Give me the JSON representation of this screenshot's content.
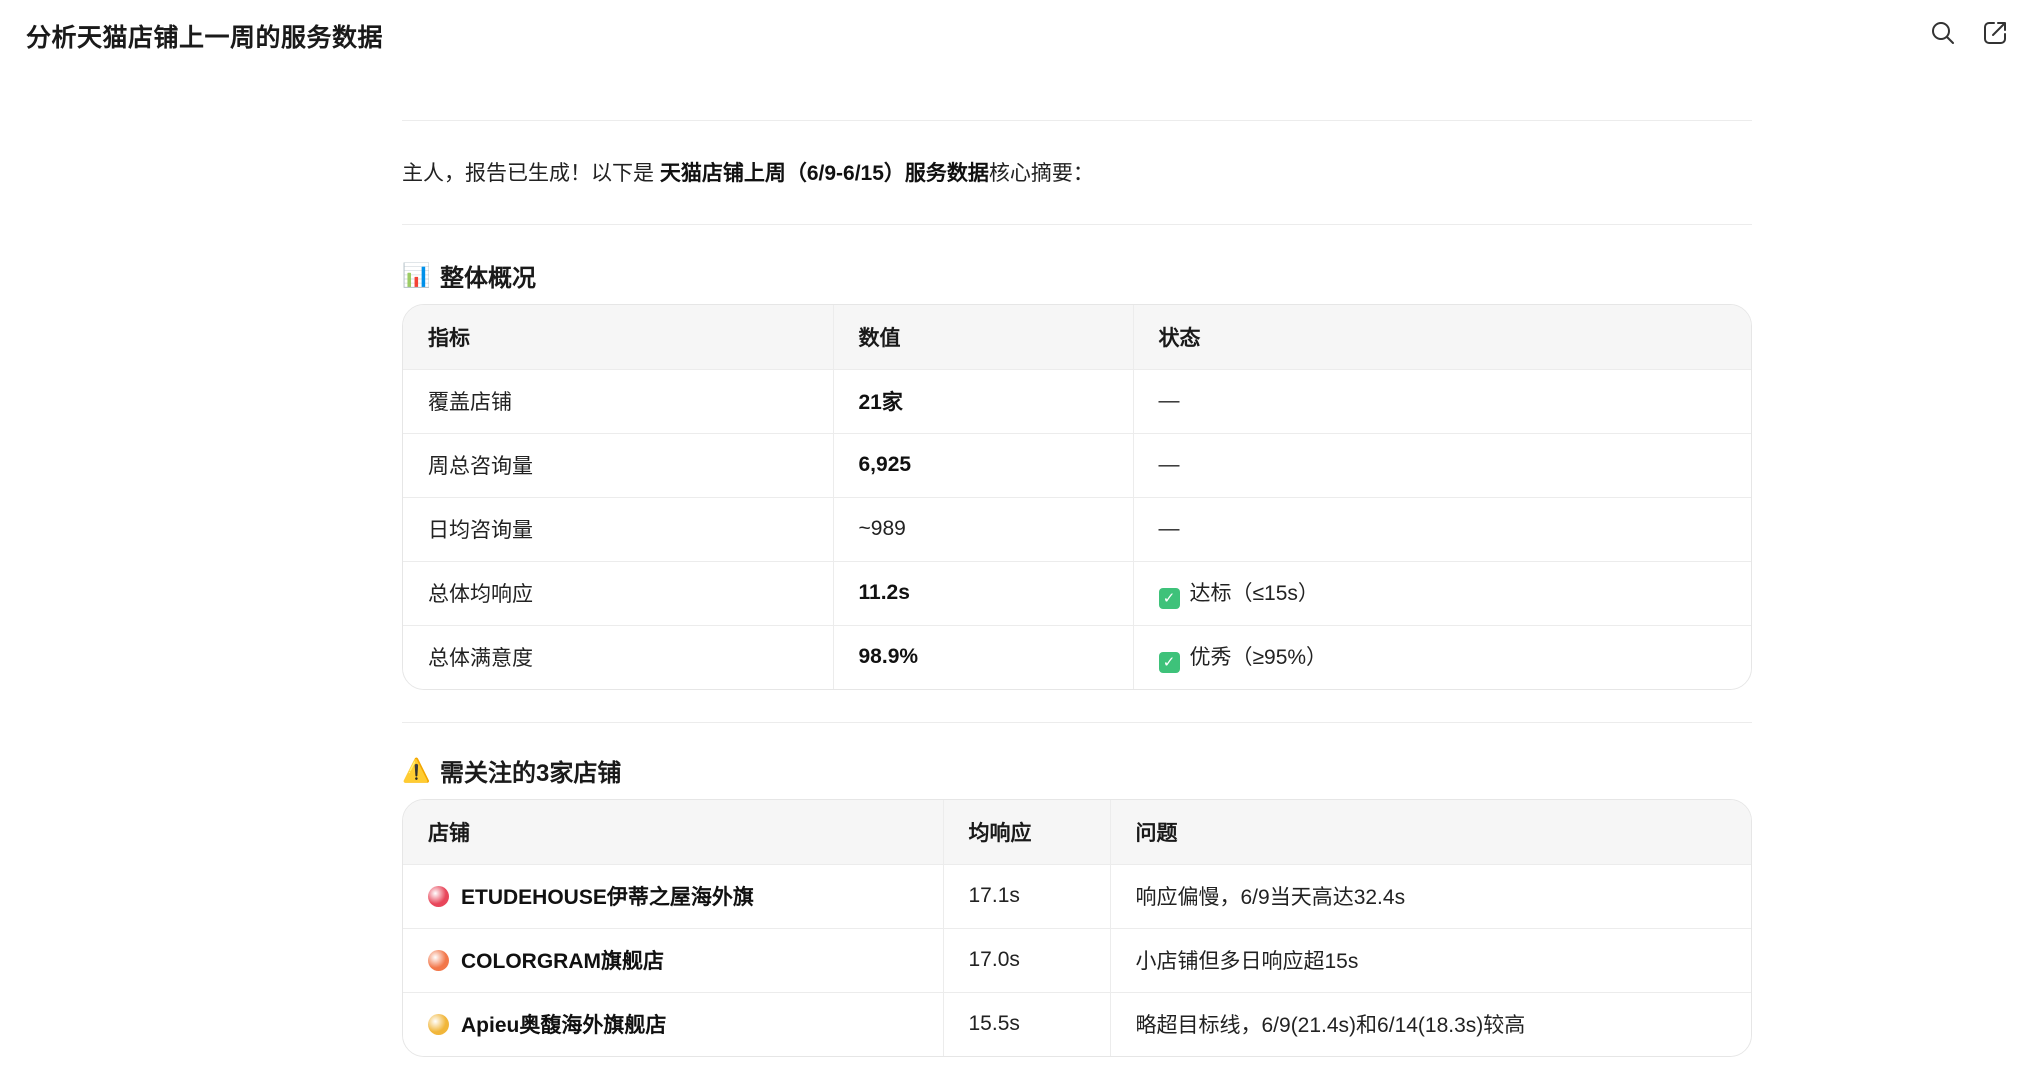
{
  "page_title": "分析天猫店铺上一周的服务数据",
  "top_icons": [
    "search-icon",
    "share-icon"
  ],
  "intro": {
    "prefix": "主人，报告已生成！以下是 ",
    "emphasis": "天猫店铺上周（6/9-6/15）服务数据",
    "suffix": "核心摘要："
  },
  "overview": {
    "emoji": "📊",
    "title": "整体概况",
    "columns": [
      "指标",
      "数值",
      "状态"
    ],
    "rows": [
      {
        "metric": "覆盖店铺",
        "value": "21家",
        "value_bold": true,
        "status": "—",
        "status_ok": false
      },
      {
        "metric": "周总咨询量",
        "value": "6,925",
        "value_bold": true,
        "status": "—",
        "status_ok": false
      },
      {
        "metric": "日均咨询量",
        "value": "~989",
        "value_bold": false,
        "status": "—",
        "status_ok": false
      },
      {
        "metric": "总体均响应",
        "value": "11.2s",
        "value_bold": true,
        "status": "达标（≤15s）",
        "status_ok": true
      },
      {
        "metric": "总体满意度",
        "value": "98.9%",
        "value_bold": true,
        "status": "优秀（≥95%）",
        "status_ok": true
      }
    ]
  },
  "attention": {
    "emoji": "⚠️",
    "title": "需关注的3家店铺",
    "columns": [
      "店铺",
      "均响应",
      "问题"
    ],
    "rows": [
      {
        "dot_color": "#e8465a",
        "store": "ETUDEHOUSE伊蒂之屋海外旗",
        "response": "17.1s",
        "issue": "响应偏慢，6/9当天高达32.4s"
      },
      {
        "dot_color": "#f2774a",
        "store": "COLORGRAM旗舰店",
        "response": "17.0s",
        "issue": "小店铺但多日响应超15s"
      },
      {
        "dot_color": "#f1b63a",
        "store": "Apieu奥馥海外旗舰店",
        "response": "15.5s",
        "issue": "略超目标线，6/9(21.4s)和6/14(18.3s)较高"
      }
    ]
  },
  "colors": {
    "check_green": "#3ec27a",
    "header_bg": "#f6f6f6",
    "border": "#e6e6e6"
  }
}
